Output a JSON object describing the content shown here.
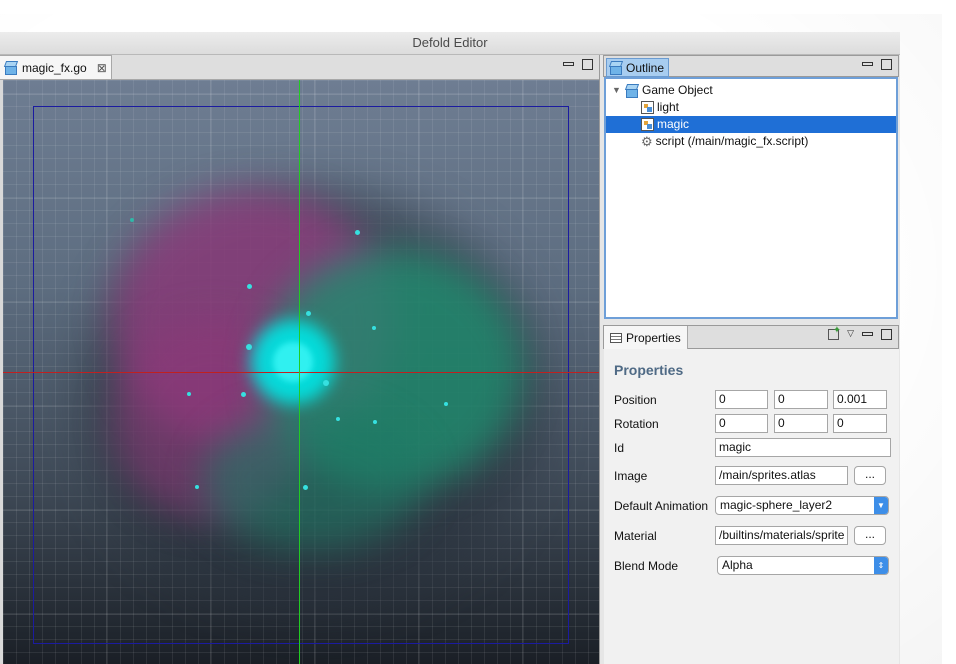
{
  "window": {
    "title": "Defold Editor"
  },
  "editor": {
    "tab_label": "magic_fx.go",
    "tab_close": "⊠"
  },
  "outline": {
    "tab_label": "Outline",
    "items": [
      {
        "label": "Game Object"
      },
      {
        "label": "light"
      },
      {
        "label": "magic"
      },
      {
        "label": "script (/main/magic_fx.script)"
      }
    ]
  },
  "properties": {
    "tab_label": "Properties",
    "title": "Properties",
    "position_label": "Position",
    "position": [
      "0",
      "0",
      "0.001"
    ],
    "rotation_label": "Rotation",
    "rotation": [
      "0",
      "0",
      "0"
    ],
    "id_label": "Id",
    "id_value": "magic",
    "image_label": "Image",
    "image_value": "/main/sprites.atlas",
    "image_button": "...",
    "default_animation_label": "Default Animation",
    "default_animation_value": "magic-sphere_layer2",
    "material_label": "Material",
    "material_value": "/builtins/materials/sprite",
    "material_button": "...",
    "blend_mode_label": "Blend Mode",
    "blend_mode_value": "Alpha"
  },
  "colors": {
    "selection": "#1f6fd6",
    "x_axis": "#c02020",
    "y_axis": "#22cc22",
    "frame": "#1b1ba0"
  }
}
